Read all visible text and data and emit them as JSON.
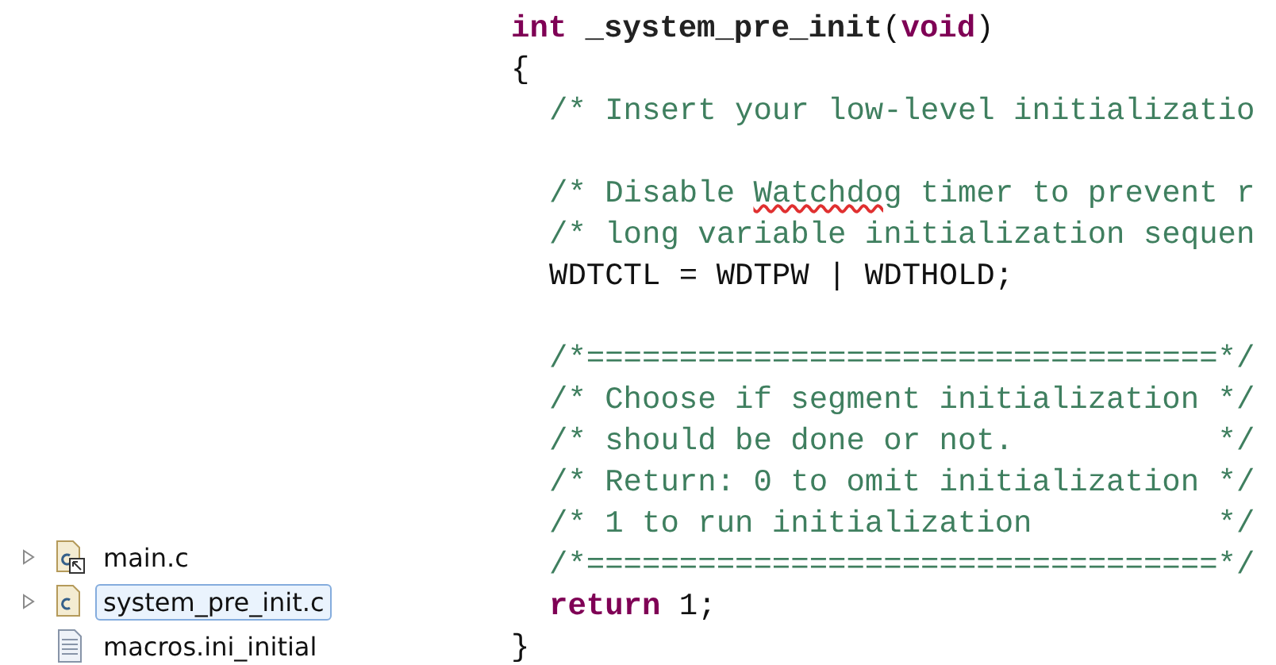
{
  "project_tree": {
    "items": [
      {
        "label": "main.c",
        "kind": "linked-source",
        "expandable": true,
        "selected": false
      },
      {
        "label": "system_pre_init.c",
        "kind": "source",
        "expandable": true,
        "selected": true
      },
      {
        "label": "macros.ini_initial",
        "kind": "text",
        "expandable": false,
        "selected": false
      }
    ]
  },
  "code_editor": {
    "lines": [
      {
        "indented": false,
        "tokens": [
          {
            "kind": "keyword",
            "text": "int"
          },
          {
            "kind": "plain-bold",
            "text": " _system_pre_init"
          },
          {
            "kind": "plain",
            "text": "("
          },
          {
            "kind": "keyword",
            "text": "void"
          },
          {
            "kind": "plain",
            "text": ")"
          }
        ]
      },
      {
        "indented": false,
        "tokens": [
          {
            "kind": "plain",
            "text": "{"
          }
        ]
      },
      {
        "indented": true,
        "tokens": [
          {
            "kind": "comment",
            "text": "/* Insert your low-level initializatio"
          }
        ]
      },
      {
        "kind": "blank"
      },
      {
        "indented": true,
        "tokens": [
          {
            "kind": "comment",
            "text": "/* Disable "
          },
          {
            "kind": "misspelled",
            "text": "Watchdog"
          },
          {
            "kind": "comment",
            "text": " timer to prevent r"
          }
        ]
      },
      {
        "indented": true,
        "tokens": [
          {
            "kind": "comment",
            "text": "/* long variable initialization sequen"
          }
        ]
      },
      {
        "indented": true,
        "tokens": [
          {
            "kind": "plain",
            "text": "WDTCTL = WDTPW | WDTHOLD;"
          }
        ]
      },
      {
        "kind": "blank"
      },
      {
        "indented": true,
        "tokens": [
          {
            "kind": "comment",
            "text": "/*==================================*/"
          }
        ]
      },
      {
        "indented": true,
        "tokens": [
          {
            "kind": "comment",
            "text": "/* Choose if segment initialization */"
          }
        ]
      },
      {
        "indented": true,
        "tokens": [
          {
            "kind": "comment",
            "text": "/* should be done or not.           */"
          }
        ]
      },
      {
        "indented": true,
        "tokens": [
          {
            "kind": "comment",
            "text": "/* Return: 0 to omit initialization */"
          }
        ]
      },
      {
        "indented": true,
        "tokens": [
          {
            "kind": "comment",
            "text": "/* 1 to run initialization          */"
          }
        ]
      },
      {
        "indented": true,
        "tokens": [
          {
            "kind": "comment",
            "text": "/*==================================*/"
          }
        ]
      },
      {
        "indented": true,
        "tokens": [
          {
            "kind": "keyword",
            "text": "return"
          },
          {
            "kind": "plain",
            "text": " 1;"
          }
        ]
      },
      {
        "indented": false,
        "tokens": [
          {
            "kind": "plain",
            "text": "}"
          }
        ]
      }
    ]
  }
}
